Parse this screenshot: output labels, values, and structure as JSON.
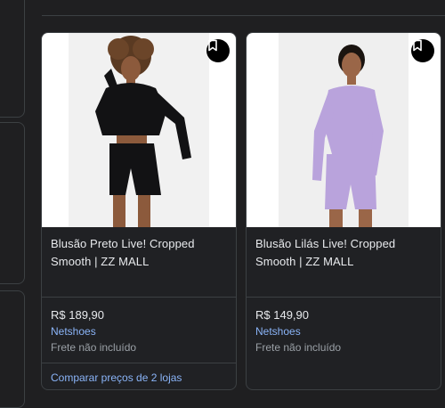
{
  "products": [
    {
      "title": "Blusão Preto Live! Cropped Smooth | ZZ MALL",
      "price": "R$ 189,90",
      "store": "Netshoes",
      "shipping": "Frete não incluído",
      "compare": "Comparar preços de 2 lojas",
      "outfit_color": "#121214"
    },
    {
      "title": "Blusão Lilás Live! Cropped Smooth | ZZ MALL",
      "price": "R$ 149,90",
      "store": "Netshoes",
      "shipping": "Frete não incluído",
      "outfit_color": "#b9a3dc"
    }
  ],
  "colors": {
    "background": "#1f1f21",
    "link": "#8ab4f8",
    "border": "#3c4043"
  },
  "icons": {
    "save": "bookmark-icon"
  }
}
